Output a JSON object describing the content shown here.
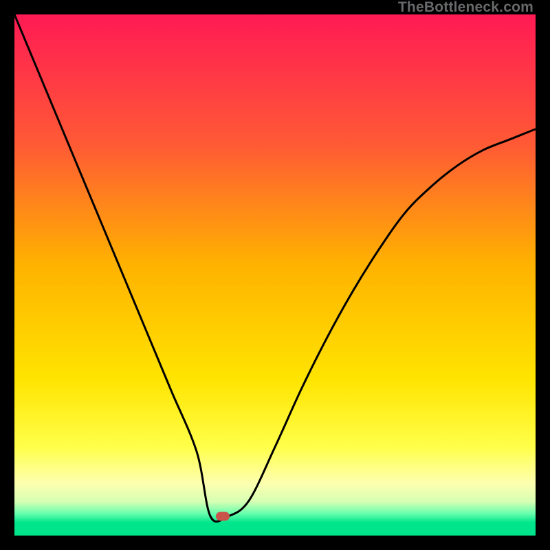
{
  "watermark": "TheBottleneck.com",
  "chart_data": {
    "type": "line",
    "title": "",
    "xlabel": "",
    "ylabel": "",
    "xlim": [
      0,
      1
    ],
    "ylim": [
      0,
      1
    ],
    "x": [
      0.0,
      0.05,
      0.1,
      0.15,
      0.2,
      0.25,
      0.3,
      0.35,
      0.376,
      0.41,
      0.45,
      0.5,
      0.55,
      0.6,
      0.65,
      0.7,
      0.75,
      0.8,
      0.85,
      0.9,
      0.95,
      1.0
    ],
    "values": [
      1.0,
      0.88,
      0.76,
      0.64,
      0.52,
      0.4,
      0.28,
      0.16,
      0.037,
      0.037,
      0.067,
      0.17,
      0.28,
      0.38,
      0.47,
      0.55,
      0.62,
      0.67,
      0.71,
      0.74,
      0.76,
      0.78
    ],
    "marker": {
      "x": 0.4,
      "y": 0.037
    },
    "gradient_stops": [
      {
        "pos": 0.0,
        "color": "#ff1a54"
      },
      {
        "pos": 0.25,
        "color": "#ff5a35"
      },
      {
        "pos": 0.48,
        "color": "#ffb200"
      },
      {
        "pos": 0.7,
        "color": "#ffe400"
      },
      {
        "pos": 0.83,
        "color": "#ffff4a"
      },
      {
        "pos": 0.9,
        "color": "#fdffb0"
      },
      {
        "pos": 0.935,
        "color": "#d6ffb3"
      },
      {
        "pos": 0.958,
        "color": "#66ffad"
      },
      {
        "pos": 0.975,
        "color": "#00e58b"
      },
      {
        "pos": 1.0,
        "color": "#00e58b"
      }
    ]
  }
}
